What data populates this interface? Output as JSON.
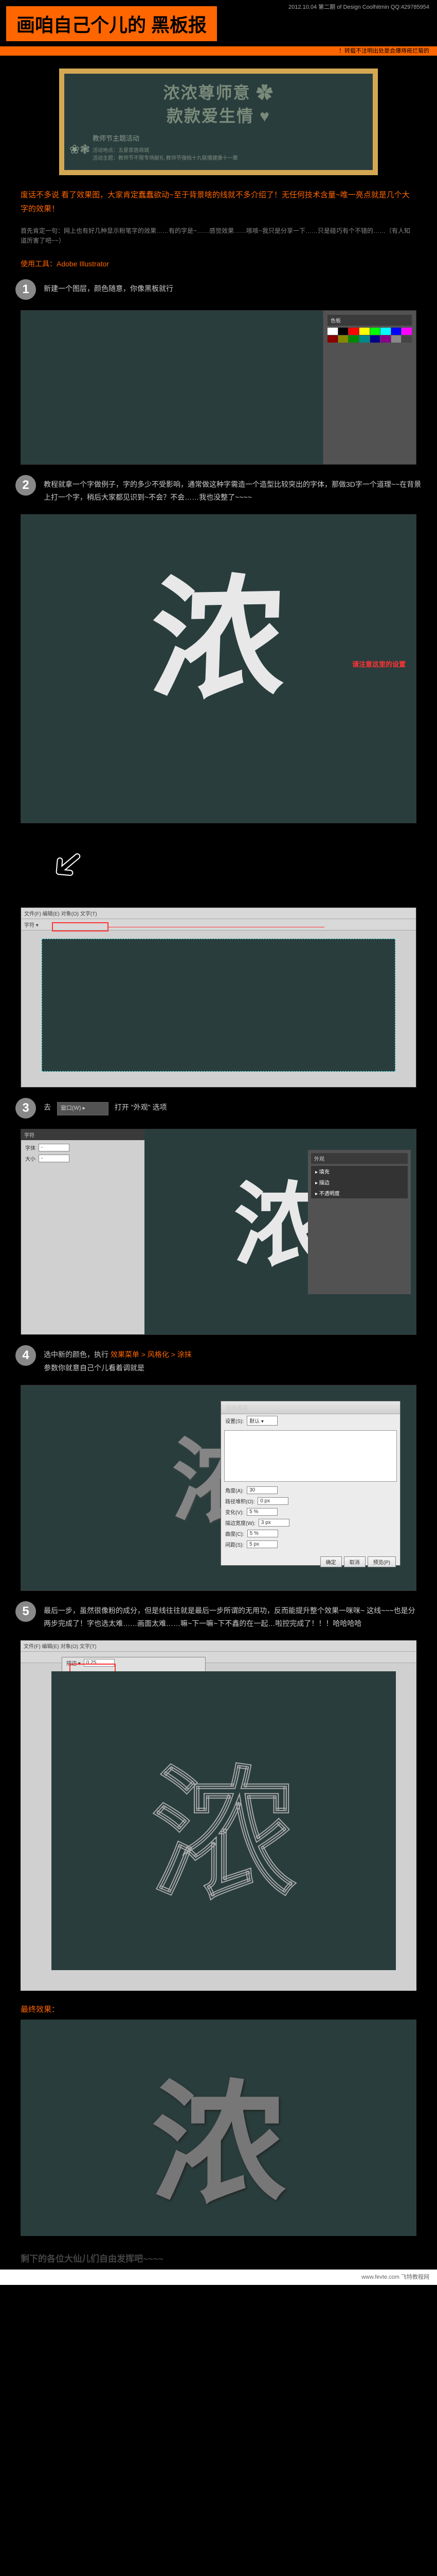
{
  "header": {
    "date_line": "2012.10.04  第二期  of Design Coolhitmin  QQ:429785954",
    "title": "画咱自己个儿的 黑板报",
    "strip_text": "！转载不注明出处是会爆痔疮烂菊的"
  },
  "blackboard": {
    "line1": "浓浓尊师意",
    "line2": "款款爱生情",
    "subtitle": "教师节主题活动",
    "meta1": "活动地点：五星家居商城",
    "meta2": "活动主题：教师节不限专场献礼 教师节强档十九联播健康十一聚"
  },
  "intro": {
    "main": "废话不多说 看了效果图，大家肯定蠢蠢欲动~至于背景啥的线就不多介绍了！无任何技术含量~唯一亮点就是几个大字的效果！",
    "sub": "首先肯定一句：网上也有好几种显示粉笔字的效果……有的字是~……感觉效果……咳咳~我只是分享一下……只是碰巧有个不错的……（有人知道厉害了吧~~）"
  },
  "tool_label": "使用工具：Adobe Illustrator",
  "steps": {
    "s1": "新建一个图层，颜色随意，你像黑板就行",
    "s2_a": "教程就拿一个字做例子，字的多少不受影响，通常做这种字需造一个造型比较突出的字体，那做3D字一个道理~~在背景上打一个字，稍后大家都见识到~不会？不会……我也没整了~~~~",
    "s2_callout": "请注意这里的设置",
    "s3_a": "去",
    "s3_b": "打开 \"外观\" 选项",
    "s4_a": "选中新的颜色，执行",
    "s4_b": "效果菜单 > 风格化 > 涂抹",
    "s4_c": "参数你就意自己个儿看着调就是",
    "s5": "最后一步，虽然很像粉的成分，但是线往往就是最后一步所谓的无用功，反而能提升整个效果一咪咪~\n这线~~~也是分两步完成了！字也选太难……画面太难……嘛~下一嘛~下不鑫的在一起…啦控完成了！！！哈哈哈哈"
  },
  "ui": {
    "toolbar_items": "文件(F)  编辑(E)  对象(O)  文字(T)",
    "panel_swatch": "色板",
    "panel_appearance": "外观",
    "panel_char": "字符",
    "dialog_brush": "涂抹选项",
    "option_angle": "角度(A):",
    "option_path": "路径堆积(O):",
    "option_variation": "变化(V):",
    "option_stroke": "描边宽度(W):",
    "option_curve": "曲度(C):",
    "option_spacing": "间距(S):",
    "btn_ok": "确定",
    "btn_cancel": "取消",
    "btn_preview": "预览(P)",
    "val_30": "30",
    "val_0": "0 px",
    "val_5": "5 %",
    "settings_label": "设置(S):"
  },
  "char": "浓",
  "final_label": "最终效果：",
  "final_tail": "剩下的各位大仙儿们自由发挥吧~~~~",
  "footer_text": "www.fevte.com 飞特教程网"
}
